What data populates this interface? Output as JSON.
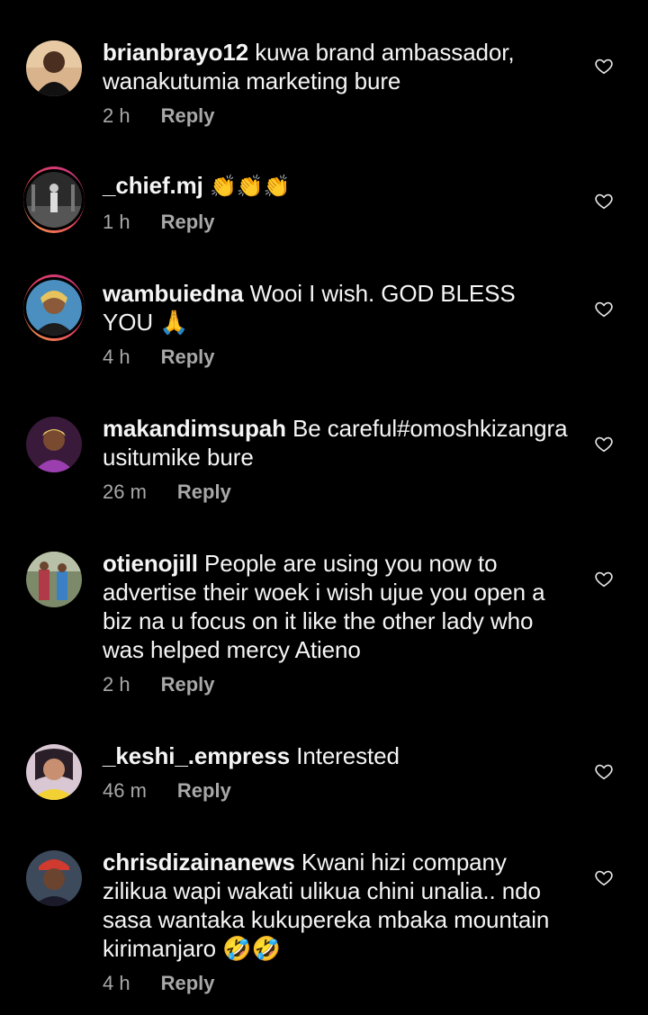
{
  "comments": [
    {
      "username": "brianbrayo12",
      "text": "kuwa brand ambassador, wanakutumia marketing bure",
      "time": "2 h",
      "reply": "Reply"
    },
    {
      "username": "_chief.mj",
      "text": "👏👏👏",
      "time": "1 h",
      "reply": "Reply"
    },
    {
      "username": "wambuiedna",
      "text": "Wooi I wish. GOD BLESS YOU 🙏",
      "time": "4 h",
      "reply": "Reply"
    },
    {
      "username": "makandimsupah",
      "text": "Be careful#omoshkizangra usitumike bure",
      "time": "26 m",
      "reply": "Reply"
    },
    {
      "username": "otienojill",
      "text": "People are using you now to advertise  their woek i wish ujue  you open a biz na u focus  on it like the other lady who was helped mercy Atieno",
      "time": "2 h",
      "reply": "Reply"
    },
    {
      "username": "_keshi_.empress",
      "text": "Interested",
      "time": "46 m",
      "reply": "Reply"
    },
    {
      "username": "chrisdizainanews",
      "text": "Kwani hizi company zilikua wapi wakati ulikua chini unalia.. ndo sasa wantaka kukupereka mbaka mountain kirimanjaro 🤣🤣",
      "time": "4 h",
      "reply": "Reply"
    }
  ]
}
